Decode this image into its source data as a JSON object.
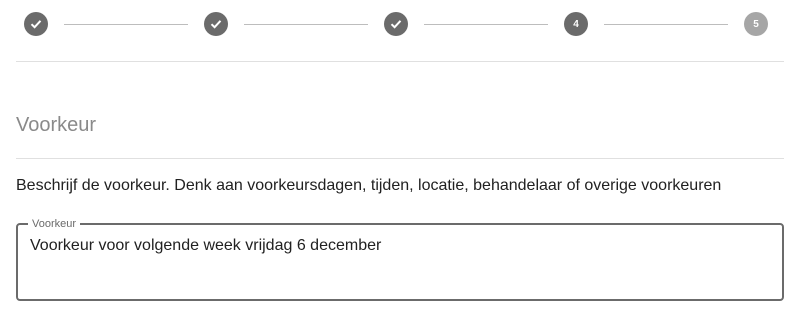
{
  "stepper": {
    "steps": [
      {
        "state": "done",
        "icon": "check-icon"
      },
      {
        "state": "done",
        "icon": "check-icon"
      },
      {
        "state": "done",
        "icon": "check-icon"
      },
      {
        "state": "active",
        "label": "4"
      },
      {
        "state": "pending",
        "label": "5"
      }
    ]
  },
  "section": {
    "title": "Voorkeur"
  },
  "description": "Beschrijf de voorkeur. Denk aan voorkeursdagen, tijden, locatie, behandelaar of overige voorkeuren",
  "field": {
    "label": "Voorkeur",
    "value": "Voorkeur voor volgende week vrijdag 6 december"
  },
  "colors": {
    "step_done": "#6b6b6b",
    "step_pending": "#a6a6a6",
    "border": "#6b6b6b"
  }
}
